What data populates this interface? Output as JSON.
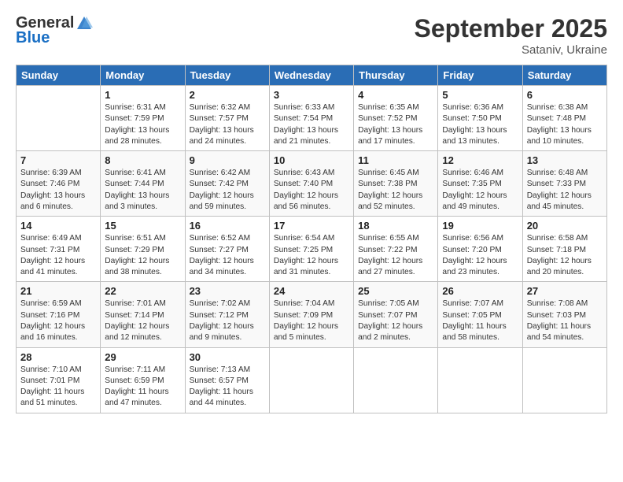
{
  "header": {
    "logo_general": "General",
    "logo_blue": "Blue",
    "month_title": "September 2025",
    "location": "Sataniv, Ukraine"
  },
  "days_of_week": [
    "Sunday",
    "Monday",
    "Tuesday",
    "Wednesday",
    "Thursday",
    "Friday",
    "Saturday"
  ],
  "weeks": [
    [
      {
        "day": "",
        "content": ""
      },
      {
        "day": "1",
        "content": "Sunrise: 6:31 AM\nSunset: 7:59 PM\nDaylight: 13 hours\nand 28 minutes."
      },
      {
        "day": "2",
        "content": "Sunrise: 6:32 AM\nSunset: 7:57 PM\nDaylight: 13 hours\nand 24 minutes."
      },
      {
        "day": "3",
        "content": "Sunrise: 6:33 AM\nSunset: 7:54 PM\nDaylight: 13 hours\nand 21 minutes."
      },
      {
        "day": "4",
        "content": "Sunrise: 6:35 AM\nSunset: 7:52 PM\nDaylight: 13 hours\nand 17 minutes."
      },
      {
        "day": "5",
        "content": "Sunrise: 6:36 AM\nSunset: 7:50 PM\nDaylight: 13 hours\nand 13 minutes."
      },
      {
        "day": "6",
        "content": "Sunrise: 6:38 AM\nSunset: 7:48 PM\nDaylight: 13 hours\nand 10 minutes."
      }
    ],
    [
      {
        "day": "7",
        "content": "Sunrise: 6:39 AM\nSunset: 7:46 PM\nDaylight: 13 hours\nand 6 minutes."
      },
      {
        "day": "8",
        "content": "Sunrise: 6:41 AM\nSunset: 7:44 PM\nDaylight: 13 hours\nand 3 minutes."
      },
      {
        "day": "9",
        "content": "Sunrise: 6:42 AM\nSunset: 7:42 PM\nDaylight: 12 hours\nand 59 minutes."
      },
      {
        "day": "10",
        "content": "Sunrise: 6:43 AM\nSunset: 7:40 PM\nDaylight: 12 hours\nand 56 minutes."
      },
      {
        "day": "11",
        "content": "Sunrise: 6:45 AM\nSunset: 7:38 PM\nDaylight: 12 hours\nand 52 minutes."
      },
      {
        "day": "12",
        "content": "Sunrise: 6:46 AM\nSunset: 7:35 PM\nDaylight: 12 hours\nand 49 minutes."
      },
      {
        "day": "13",
        "content": "Sunrise: 6:48 AM\nSunset: 7:33 PM\nDaylight: 12 hours\nand 45 minutes."
      }
    ],
    [
      {
        "day": "14",
        "content": "Sunrise: 6:49 AM\nSunset: 7:31 PM\nDaylight: 12 hours\nand 41 minutes."
      },
      {
        "day": "15",
        "content": "Sunrise: 6:51 AM\nSunset: 7:29 PM\nDaylight: 12 hours\nand 38 minutes."
      },
      {
        "day": "16",
        "content": "Sunrise: 6:52 AM\nSunset: 7:27 PM\nDaylight: 12 hours\nand 34 minutes."
      },
      {
        "day": "17",
        "content": "Sunrise: 6:54 AM\nSunset: 7:25 PM\nDaylight: 12 hours\nand 31 minutes."
      },
      {
        "day": "18",
        "content": "Sunrise: 6:55 AM\nSunset: 7:22 PM\nDaylight: 12 hours\nand 27 minutes."
      },
      {
        "day": "19",
        "content": "Sunrise: 6:56 AM\nSunset: 7:20 PM\nDaylight: 12 hours\nand 23 minutes."
      },
      {
        "day": "20",
        "content": "Sunrise: 6:58 AM\nSunset: 7:18 PM\nDaylight: 12 hours\nand 20 minutes."
      }
    ],
    [
      {
        "day": "21",
        "content": "Sunrise: 6:59 AM\nSunset: 7:16 PM\nDaylight: 12 hours\nand 16 minutes."
      },
      {
        "day": "22",
        "content": "Sunrise: 7:01 AM\nSunset: 7:14 PM\nDaylight: 12 hours\nand 12 minutes."
      },
      {
        "day": "23",
        "content": "Sunrise: 7:02 AM\nSunset: 7:12 PM\nDaylight: 12 hours\nand 9 minutes."
      },
      {
        "day": "24",
        "content": "Sunrise: 7:04 AM\nSunset: 7:09 PM\nDaylight: 12 hours\nand 5 minutes."
      },
      {
        "day": "25",
        "content": "Sunrise: 7:05 AM\nSunset: 7:07 PM\nDaylight: 12 hours\nand 2 minutes."
      },
      {
        "day": "26",
        "content": "Sunrise: 7:07 AM\nSunset: 7:05 PM\nDaylight: 11 hours\nand 58 minutes."
      },
      {
        "day": "27",
        "content": "Sunrise: 7:08 AM\nSunset: 7:03 PM\nDaylight: 11 hours\nand 54 minutes."
      }
    ],
    [
      {
        "day": "28",
        "content": "Sunrise: 7:10 AM\nSunset: 7:01 PM\nDaylight: 11 hours\nand 51 minutes."
      },
      {
        "day": "29",
        "content": "Sunrise: 7:11 AM\nSunset: 6:59 PM\nDaylight: 11 hours\nand 47 minutes."
      },
      {
        "day": "30",
        "content": "Sunrise: 7:13 AM\nSunset: 6:57 PM\nDaylight: 11 hours\nand 44 minutes."
      },
      {
        "day": "",
        "content": ""
      },
      {
        "day": "",
        "content": ""
      },
      {
        "day": "",
        "content": ""
      },
      {
        "day": "",
        "content": ""
      }
    ]
  ]
}
